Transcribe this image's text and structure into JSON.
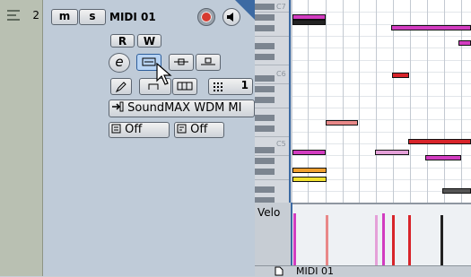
{
  "track": {
    "number": "2",
    "mute_label": "m",
    "solo_label": "s",
    "name": "MIDI 01",
    "read_label": "R",
    "write_label": "W",
    "edit_label": "e",
    "output_label": "SoundMAX WDM MI",
    "program_label": "1",
    "insert_off_label": "Off",
    "sends_off_label": "Off"
  },
  "editor": {
    "octave_labels": [
      "C7",
      "C6",
      "C5"
    ],
    "velocity_label": "Velo",
    "status_title": "MIDI 01"
  },
  "colors": {
    "inspector_bg": "#bfcbd8",
    "record": "#d63a2f",
    "selected_button": "#b8d4f4",
    "note_magenta": "#d23cc0",
    "note_red": "#d8242a",
    "note_pink": "#e88888",
    "note_orange": "#f0a030",
    "note_yellow": "#f0e030",
    "note_dark": "#222222"
  },
  "icons": [
    "lines-icon",
    "record-icon",
    "speaker-icon",
    "edit-icon",
    "lane-icon",
    "connect-icon",
    "connect-alt-icon",
    "pencil-icon",
    "loop-icon",
    "grid-icon",
    "output-icon",
    "insert-icon",
    "send-icon",
    "mouse-cursor-icon",
    "page-icon"
  ]
}
